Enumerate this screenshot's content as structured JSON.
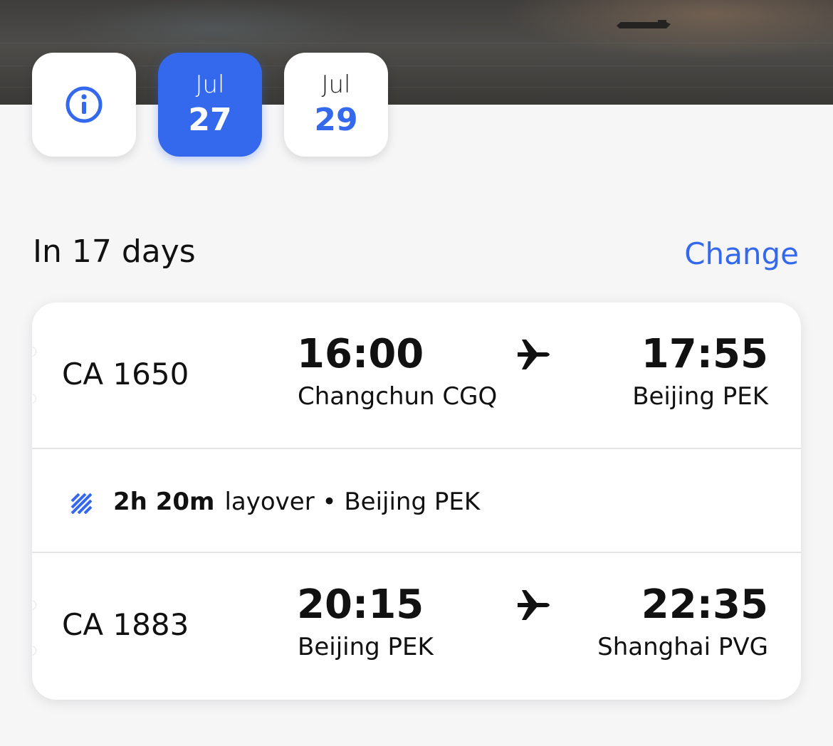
{
  "date_tiles": [
    {
      "icon": "info-icon"
    },
    {
      "month": "Jul",
      "day": "27",
      "selected": true
    },
    {
      "month": "Jul",
      "day": "29",
      "selected": false
    }
  ],
  "header": {
    "days_label": "In 17 days",
    "change_label": "Change"
  },
  "colors": {
    "accent": "#3469ee",
    "background": "#f6f6f7",
    "card": "#ffffff"
  },
  "itinerary": {
    "segments": [
      {
        "flight": "CA 1650",
        "dep_time": "16:00",
        "dep_city": "Changchun CGQ",
        "arr_time": "17:55",
        "arr_city": "Beijing PEK"
      },
      {
        "flight": "CA 1883",
        "dep_time": "20:15",
        "dep_city": "Beijing PEK",
        "arr_time": "22:35",
        "arr_city": "Shanghai PVG"
      }
    ],
    "layover": {
      "duration": "2h 20m",
      "text": "layover • Beijing PEK",
      "icon": "layover-hatch-icon"
    }
  }
}
